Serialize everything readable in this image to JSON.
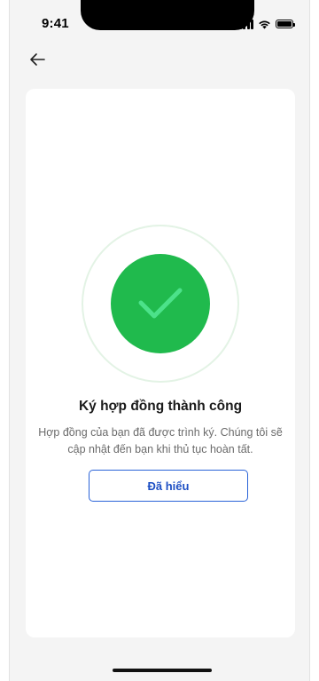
{
  "status_bar": {
    "time": "9:41",
    "icons": [
      "signal-icon",
      "wifi-icon",
      "battery-icon"
    ]
  },
  "nav": {
    "back_icon": "arrow-left-icon"
  },
  "result": {
    "icon": "checkmark-icon",
    "title": "Ký hợp đồng thành công",
    "description": "Hợp đồng của bạn đã được trình ký. Chúng tôi sẽ cập nhật đến bạn khi thủ tục hoàn tất.",
    "button_label": "Đã hiểu"
  },
  "colors": {
    "success": "#20ba4d",
    "success_ring": "#e3f3e5",
    "primary": "#2a63d8",
    "background": "#f4f4f4",
    "card": "#ffffff"
  }
}
